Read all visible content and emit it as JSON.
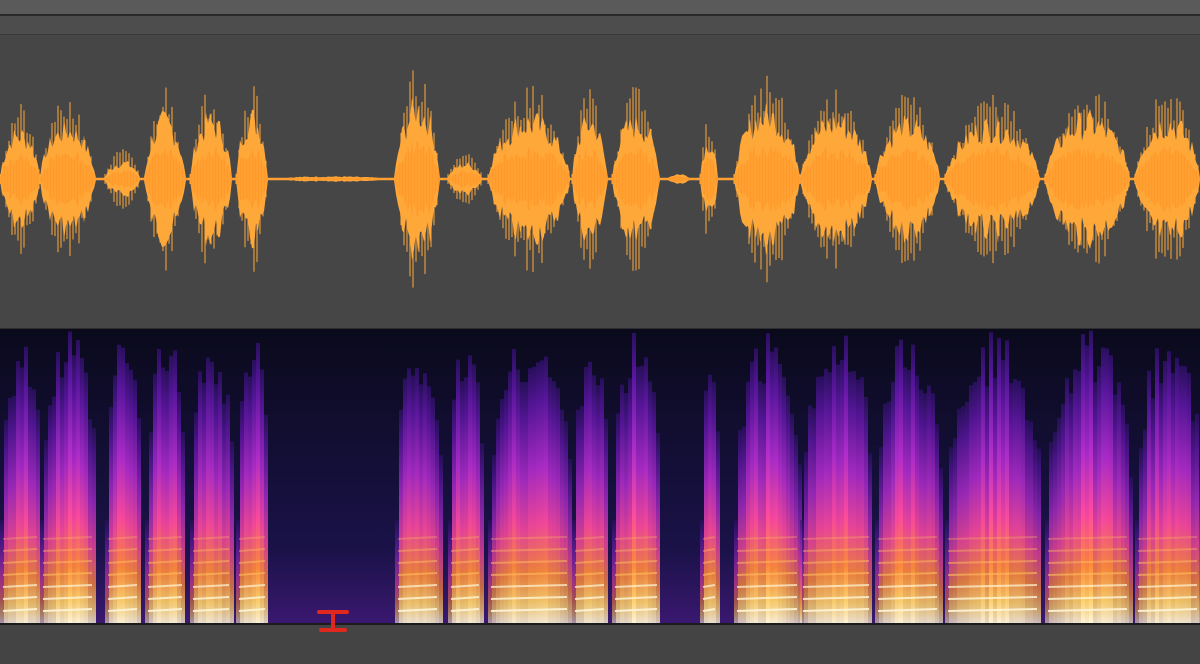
{
  "app": {
    "view": "waveform-and-spectrogram",
    "colors": {
      "waveform": "#ffa83a",
      "waveform_core": "#ff9a2a",
      "waveform_background": "#464646",
      "spectrogram_background": "#0a0a1c",
      "spectrogram_palette": [
        "#0a0a1c",
        "#2a1060",
        "#6a18b0",
        "#b82fd0",
        "#ff5aa0",
        "#ff8a3a",
        "#ffd16a",
        "#fff6d8"
      ],
      "cursor_marker": "#e0281e"
    }
  },
  "cursor": {
    "icon": "i-beam-cursor-icon"
  }
}
